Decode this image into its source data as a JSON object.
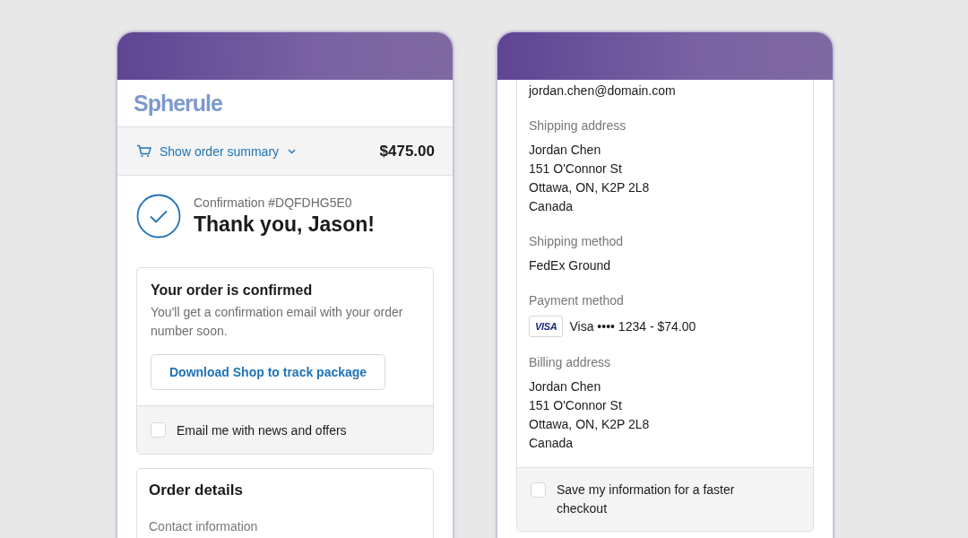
{
  "left_screen": {
    "logo": "Spherule",
    "summary": {
      "label": "Show order summary",
      "total": "$475.00"
    },
    "confirmation": {
      "number": "Confirmation #DQFDHG5E0",
      "title": "Thank you, Jason!"
    },
    "order_card": {
      "title": "Your order is confirmed",
      "text": "You'll get a confirmation email with your order number soon.",
      "button": "Download Shop to track package",
      "checkbox": {
        "label": "Email me with news and offers",
        "checked": false
      }
    },
    "details_card": {
      "title": "Order details",
      "sections": [
        {
          "label": "Contact information"
        }
      ]
    }
  },
  "right_screen": {
    "contact_value": "jordan.chen@domain.com",
    "sections": [
      {
        "kind": "lines",
        "label": "Shipping address",
        "lines": [
          "Jordan Chen",
          "151 O'Connor St",
          "Ottawa, ON, K2P 2L8",
          "Canada"
        ]
      },
      {
        "kind": "lines",
        "label": "Shipping method",
        "lines": [
          "FedEx Ground"
        ]
      },
      {
        "kind": "payment",
        "label": "Payment method",
        "card_brand": "VISA",
        "text": "Visa •••• 1234 - $74.00"
      },
      {
        "kind": "lines",
        "label": "Billing address",
        "lines": [
          "Jordan Chen",
          "151 O'Connor St",
          "Ottawa, ON, K2P 2L8",
          "Canada"
        ]
      }
    ],
    "checkbox": {
      "label": "Save my information for a faster checkout",
      "checked": false
    }
  }
}
